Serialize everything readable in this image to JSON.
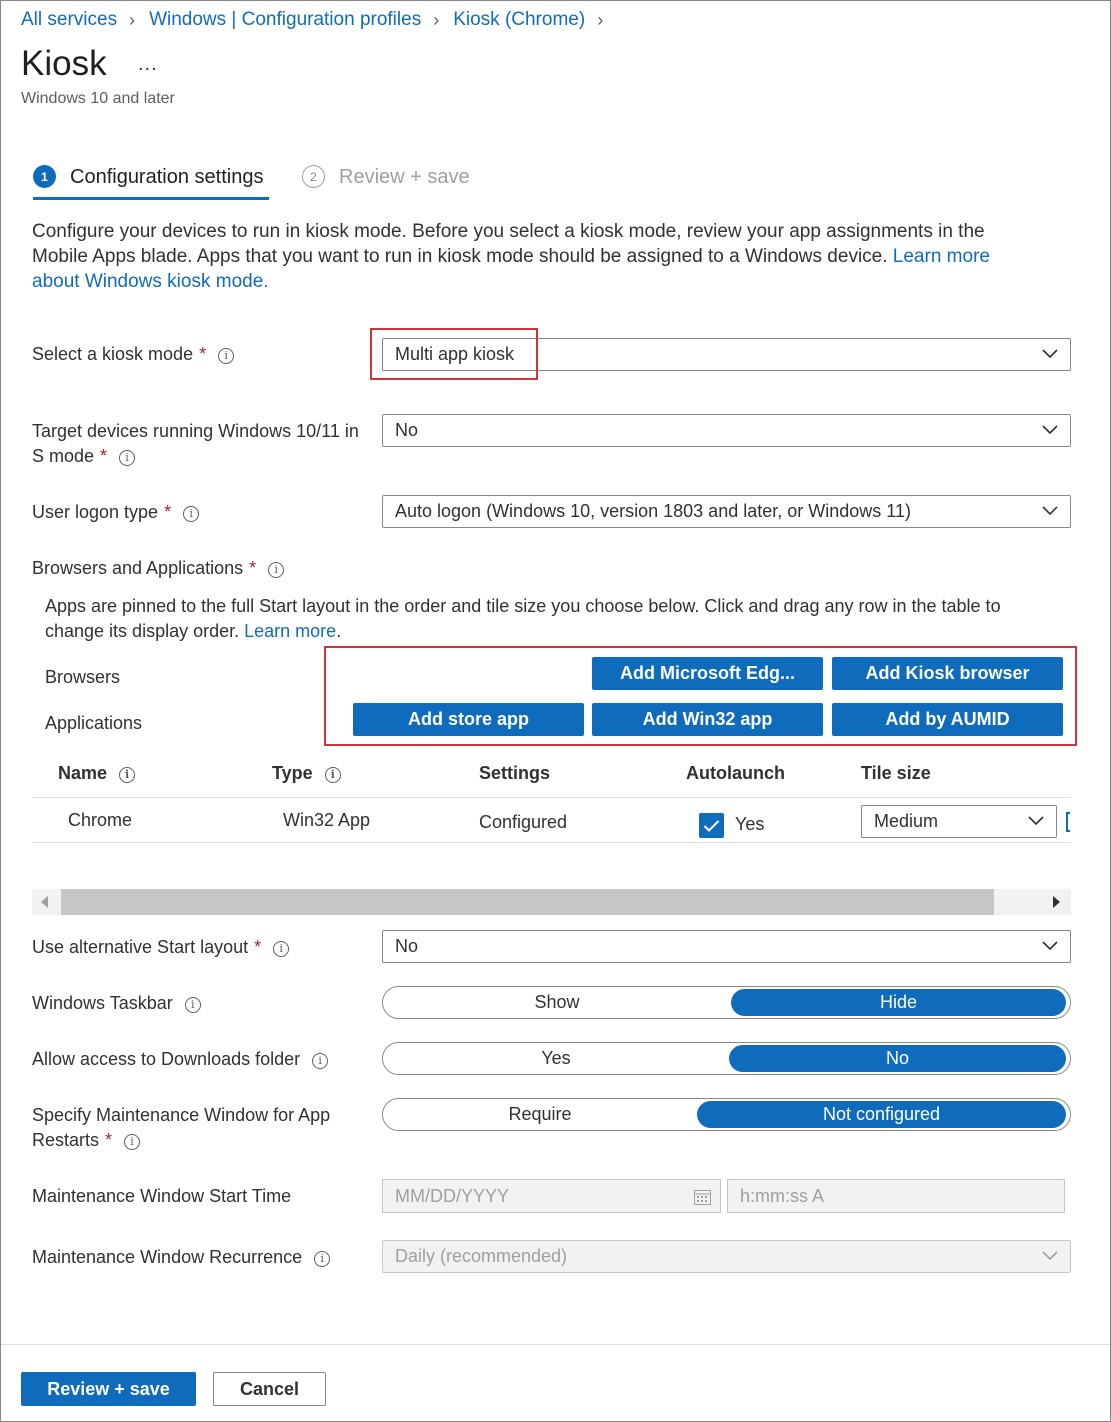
{
  "breadcrumb": {
    "items": [
      "All services",
      "Windows | Configuration profiles",
      "Kiosk (Chrome)"
    ]
  },
  "header": {
    "title": "Kiosk",
    "more": "...",
    "subtitle": "Windows 10 and later"
  },
  "steps": [
    {
      "number": "1",
      "label": "Configuration settings"
    },
    {
      "number": "2",
      "label": "Review + save"
    }
  ],
  "intro": {
    "text": "Configure your devices to run in kiosk mode. Before you select a kiosk mode, review your app assignments in the Mobile Apps blade. Apps that you want to run in kiosk mode should be assigned to a Windows device. ",
    "link": "Learn more about Windows kiosk mode."
  },
  "fields": {
    "kiosk_mode": {
      "label": "Select a kiosk mode",
      "required": "*",
      "value": "Multi app kiosk"
    },
    "s_mode": {
      "label_line1": "Target devices running Windows 10/11 in",
      "label_line2": "S mode",
      "required": "*",
      "value": "No"
    },
    "logon_type": {
      "label": "User logon type",
      "required": "*",
      "value": "Auto logon (Windows 10, version 1803 and later, or Windows 11)"
    },
    "browsers_apps": {
      "label": "Browsers and Applications",
      "required": "*"
    }
  },
  "apps_section": {
    "description": "Apps are pinned to the full Start layout in the order and tile size you choose below. Click and drag any row in the table to change its display order. ",
    "learn_more": "Learn more",
    "learn_more_suffix": ".",
    "browsers_label": "Browsers",
    "applications_label": "Applications",
    "buttons": {
      "add_edge": "Add Microsoft Edg...",
      "add_kiosk_browser": "Add Kiosk browser",
      "add_store_app": "Add store app",
      "add_win32_app": "Add Win32 app",
      "add_by_aumid": "Add by AUMID"
    }
  },
  "table": {
    "headers": {
      "name": "Name",
      "type": "Type",
      "settings": "Settings",
      "autolaunch": "Autolaunch",
      "tile_size": "Tile size"
    },
    "rows": [
      {
        "name": "Chrome",
        "type": "Win32 App",
        "settings": "Configured",
        "autolaunch": "Yes",
        "autolaunch_checked": true,
        "tile_size": "Medium"
      }
    ]
  },
  "settings": {
    "alt_start_layout": {
      "label": "Use alternative Start layout",
      "required": "*",
      "value": "No"
    },
    "taskbar": {
      "label": "Windows Taskbar",
      "options": [
        "Show",
        "Hide"
      ],
      "selected": "Hide"
    },
    "downloads": {
      "label": "Allow access to Downloads folder",
      "options": [
        "Yes",
        "No"
      ],
      "selected": "No"
    },
    "maintenance_window": {
      "label_line1": "Specify Maintenance Window for App",
      "label_line2": "Restarts",
      "required": "*",
      "options": [
        "Require",
        "Not configured"
      ],
      "selected": "Not configured"
    },
    "start_time": {
      "label": "Maintenance Window Start Time",
      "date_placeholder": "MM/DD/YYYY",
      "time_placeholder": "h:mm:ss A"
    },
    "recurrence": {
      "label": "Maintenance Window Recurrence",
      "value": "Daily (recommended)"
    }
  },
  "footer": {
    "primary": "Review + save",
    "secondary": "Cancel"
  },
  "colors": {
    "accent": "#0f6cbd",
    "highlight_box": "#d13438",
    "required": "#a4262c"
  }
}
